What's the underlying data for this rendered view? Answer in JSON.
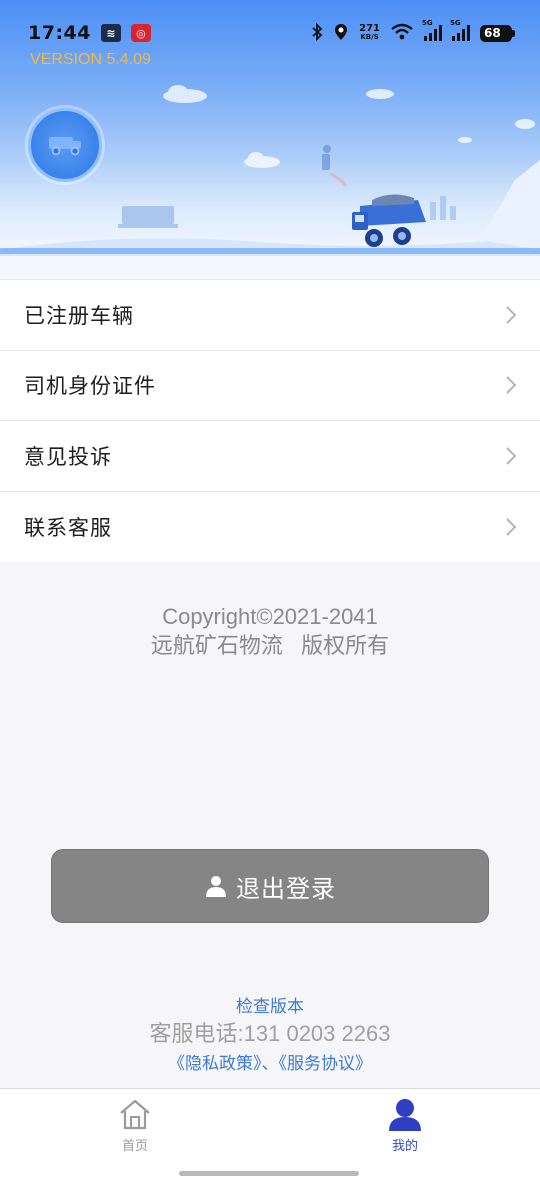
{
  "status_bar": {
    "time": "17:44",
    "net_speed_value": "271",
    "net_speed_unit": "KB/S",
    "signal_tag": "5G",
    "battery": "68"
  },
  "header": {
    "version": "VERSION 5.4.09",
    "avatar_icon": "truck-icon"
  },
  "menu": {
    "items": [
      {
        "label": "已注册车辆"
      },
      {
        "label": "司机身份证件"
      },
      {
        "label": "意见投诉"
      },
      {
        "label": "联系客服"
      }
    ]
  },
  "copyright": {
    "line1": "Copyright©2021-2041",
    "line2": "远航矿石物流   版权所有"
  },
  "logout": {
    "label": "退出登录",
    "icon": "user-icon"
  },
  "footer": {
    "check_version": "检查版本",
    "phone": "客服电话:131 0203 2263",
    "policies": "《隐私政策》、《服务协议》"
  },
  "tabbar": {
    "tabs": [
      {
        "label": "首页",
        "icon": "home-icon",
        "active": false
      },
      {
        "label": "我的",
        "icon": "person-icon",
        "active": true
      }
    ]
  },
  "colors": {
    "accent": "#3d7bd4",
    "version_text": "#f5b841",
    "logout_bg": "#858585",
    "active_tab": "#2f4fbf"
  }
}
